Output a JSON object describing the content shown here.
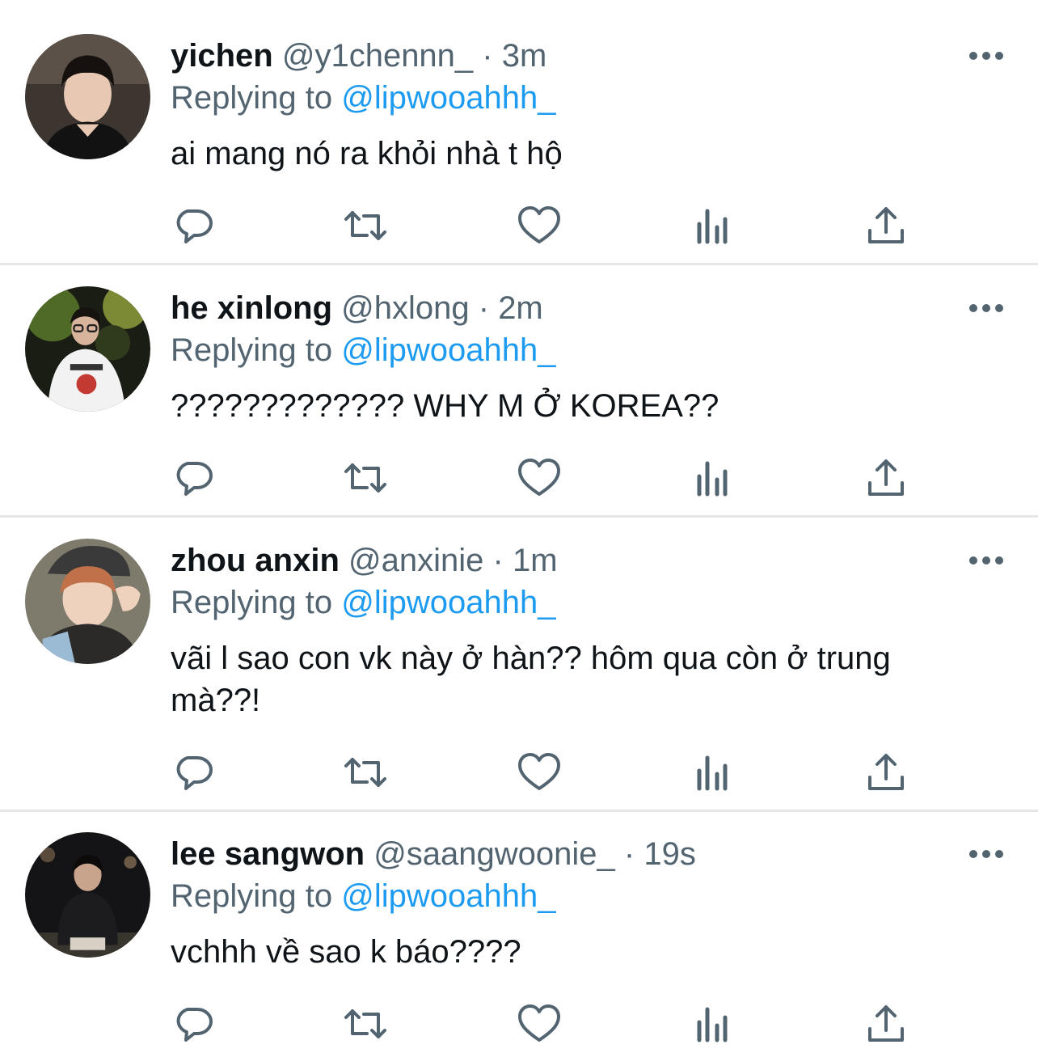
{
  "replies": [
    {
      "name": "yichen",
      "handle": "@y1chennn_",
      "separator": "·",
      "time": "3m",
      "replying_prefix": "Replying to",
      "replying_to": "@lipwooahhh_",
      "text": "ai mang nó ra khỏi nhà t hộ",
      "avatar_icon": "avatar-photo"
    },
    {
      "name": "he xinlong",
      "handle": "@hxlong",
      "separator": "·",
      "time": "2m",
      "replying_prefix": "Replying to",
      "replying_to": "@lipwooahhh_",
      "text": "????????????? WHY M Ở KOREA??",
      "avatar_icon": "avatar-photo"
    },
    {
      "name": "zhou anxin",
      "handle": "@anxinie",
      "separator": "·",
      "time": "1m",
      "replying_prefix": "Replying to",
      "replying_to": "@lipwooahhh_",
      "text": "vãi l sao con vk này ở hàn?? hôm qua còn ở trung mà??!",
      "avatar_icon": "avatar-photo"
    },
    {
      "name": "lee sangwon",
      "handle": "@saangwoonie_",
      "separator": "·",
      "time": "19s",
      "replying_prefix": "Replying to",
      "replying_to": "@lipwooahhh_",
      "text": "vchhh về sao k báo????",
      "avatar_icon": "avatar-photo"
    }
  ],
  "action_icons": [
    "reply-icon",
    "retweet-icon",
    "like-icon",
    "views-icon",
    "share-icon"
  ],
  "colors": {
    "text": "#0f1419",
    "secondary": "#536471",
    "accent": "#1d9bf0",
    "divider": "#e4e6e8"
  }
}
